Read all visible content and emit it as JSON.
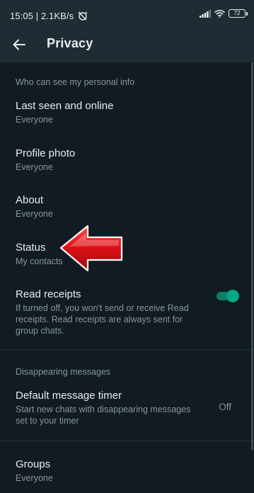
{
  "status_bar": {
    "time": "15:05",
    "speed": "2.1KB/s",
    "battery": "72"
  },
  "header": {
    "title": "Privacy",
    "back_icon": "arrow-left-icon"
  },
  "sections": {
    "personal_info": {
      "header": "Who can see my personal info",
      "items": [
        {
          "title": "Last seen and online",
          "value": "Everyone"
        },
        {
          "title": "Profile photo",
          "value": "Everyone"
        },
        {
          "title": "About",
          "value": "Everyone"
        },
        {
          "title": "Status",
          "value": "My contacts"
        }
      ],
      "read_receipts": {
        "title": "Read receipts",
        "description": "If turned off, you won't send or receive Read receipts. Read receipts are always sent for group chats.",
        "enabled": true
      }
    },
    "disappearing": {
      "header": "Disappearing messages",
      "timer": {
        "title": "Default message timer",
        "description": "Start new chats with disappearing messages set to your timer",
        "value": "Off"
      }
    },
    "groups": {
      "title": "Groups",
      "value": "Everyone"
    }
  },
  "annotation": {
    "arrow_icon": "red-arrow-pointer",
    "color": "#d8141a"
  },
  "colors": {
    "background": "#121b22",
    "bar": "#1f2c34",
    "accent": "#00a884",
    "secondary_text": "#8696a0"
  }
}
